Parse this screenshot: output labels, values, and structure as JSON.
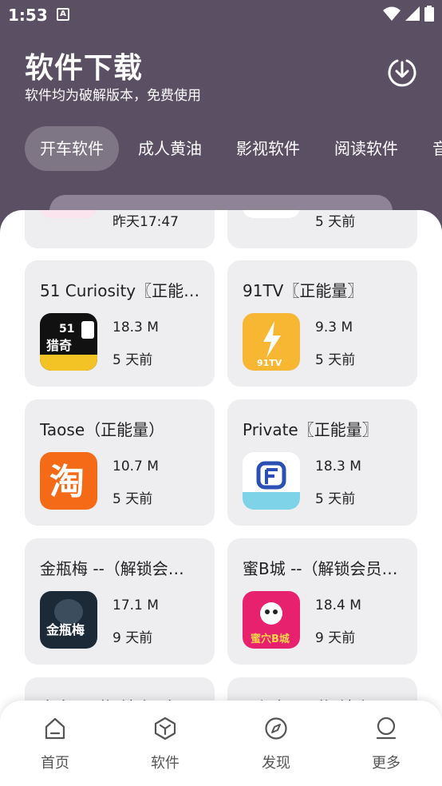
{
  "status": {
    "time": "1:53",
    "notif": "A"
  },
  "header": {
    "title": "软件下载",
    "subtitle": "软件均为破解版本，免费使用"
  },
  "tabs": [
    "开车软件",
    "成人黄油",
    "影视软件",
    "阅读软件",
    "音"
  ],
  "partial_top": [
    {
      "date": "昨天17:47"
    },
    {
      "date": "5 天前"
    }
  ],
  "cards": [
    {
      "title": "51 Curiosity〖正能…",
      "size": "18.3 M",
      "date": "5 天前",
      "icon": "51-curiosity-icon",
      "icon_text": "51猎奇"
    },
    {
      "title": "91TV〖正能量〗",
      "size": "9.3 M",
      "date": "5 天前",
      "icon": "91tv-icon",
      "icon_text": "91TV"
    },
    {
      "title": "Taose（正能量）",
      "size": "10.7 M",
      "date": "5 天前",
      "icon": "taose-icon",
      "icon_text": "淘"
    },
    {
      "title": "Private〖正能量〗",
      "size": "18.3 M",
      "date": "5 天前",
      "icon": "private-icon",
      "icon_text": ""
    },
    {
      "title": "金瓶梅 --（解锁会…",
      "size": "17.1 M",
      "date": "9 天前",
      "icon": "jinpingmei-icon",
      "icon_text": "金瓶梅"
    },
    {
      "title": "蜜B城 --（解锁会员…",
      "size": "18.4 M",
      "date": "9 天前",
      "icon": "mibcheng-icon",
      "icon_text": "蜜穴B城"
    }
  ],
  "partial_bottom": [
    {
      "title": "多多 --（解锁会员）"
    },
    {
      "title": "寻视频 --（解锁会…"
    }
  ],
  "nav": [
    {
      "label": "首页",
      "icon": "home-icon"
    },
    {
      "label": "软件",
      "icon": "box-icon"
    },
    {
      "label": "发现",
      "icon": "compass-icon"
    },
    {
      "label": "更多",
      "icon": "person-icon"
    }
  ],
  "colors": {
    "header_bg": "#5a4f63",
    "card_bg": "#eeedf0"
  }
}
